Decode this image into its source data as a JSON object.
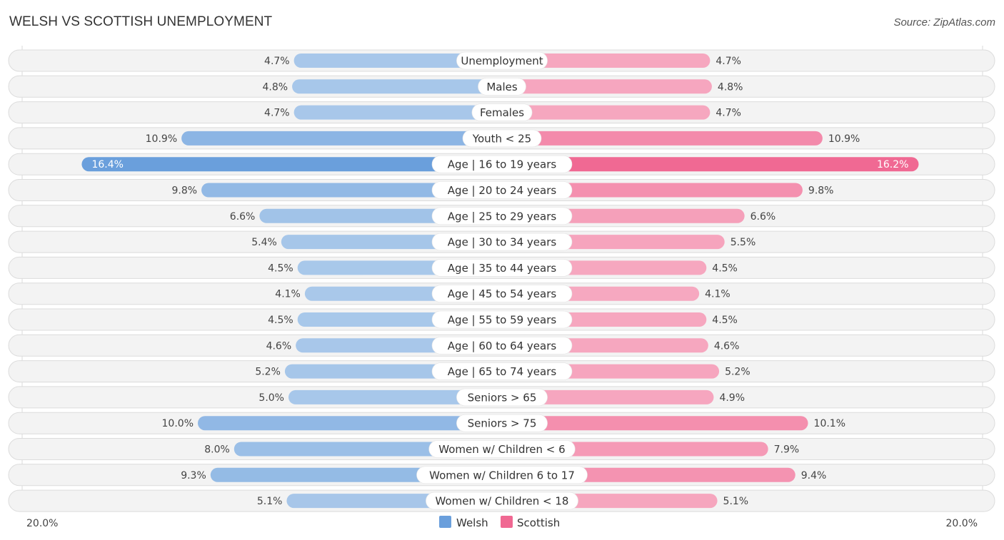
{
  "header": {
    "title": "WELSH VS SCOTTISH UNEMPLOYMENT",
    "source": "Source: ZipAtlas.com"
  },
  "colors": {
    "welsh": "#6a9fdc",
    "welsh_light": "#a9c8ea",
    "scottish": "#f06892",
    "scottish_light": "#f6a8c0"
  },
  "chart_data": {
    "type": "bar",
    "orientation": "horizontal-diverging",
    "title": "WELSH VS SCOTTISH UNEMPLOYMENT",
    "xlim": [
      -20,
      20
    ],
    "axis_labels": {
      "left": "20.0%",
      "right": "20.0%"
    },
    "legend": {
      "position": "bottom-center",
      "entries": [
        "Welsh",
        "Scottish"
      ]
    },
    "categories": [
      "Unemployment",
      "Males",
      "Females",
      "Youth < 25",
      "Age | 16 to 19 years",
      "Age | 20 to 24 years",
      "Age | 25 to 29 years",
      "Age | 30 to 34 years",
      "Age | 35 to 44 years",
      "Age | 45 to 54 years",
      "Age | 55 to 59 years",
      "Age | 60 to 64 years",
      "Age | 65 to 74 years",
      "Seniors > 65",
      "Seniors > 75",
      "Women w/ Children < 6",
      "Women w/ Children 6 to 17",
      "Women w/ Children < 18"
    ],
    "series": [
      {
        "name": "Welsh",
        "side": "left",
        "values": [
          4.7,
          4.8,
          4.7,
          10.9,
          16.4,
          9.8,
          6.6,
          5.4,
          4.5,
          4.1,
          4.5,
          4.6,
          5.2,
          5.0,
          10.0,
          8.0,
          9.3,
          5.1
        ],
        "labels": [
          "4.7%",
          "4.8%",
          "4.7%",
          "10.9%",
          "16.4%",
          "9.8%",
          "6.6%",
          "5.4%",
          "4.5%",
          "4.1%",
          "4.5%",
          "4.6%",
          "5.2%",
          "5.0%",
          "10.0%",
          "8.0%",
          "9.3%",
          "5.1%"
        ]
      },
      {
        "name": "Scottish",
        "side": "right",
        "values": [
          4.7,
          4.8,
          4.7,
          10.9,
          16.2,
          9.8,
          6.6,
          5.5,
          4.5,
          4.1,
          4.5,
          4.6,
          5.2,
          4.9,
          10.1,
          7.9,
          9.4,
          5.1
        ],
        "labels": [
          "4.7%",
          "4.8%",
          "4.7%",
          "10.9%",
          "16.2%",
          "9.8%",
          "6.6%",
          "5.5%",
          "4.5%",
          "4.1%",
          "4.5%",
          "4.6%",
          "5.2%",
          "4.9%",
          "10.1%",
          "7.9%",
          "9.4%",
          "5.1%"
        ]
      }
    ]
  }
}
